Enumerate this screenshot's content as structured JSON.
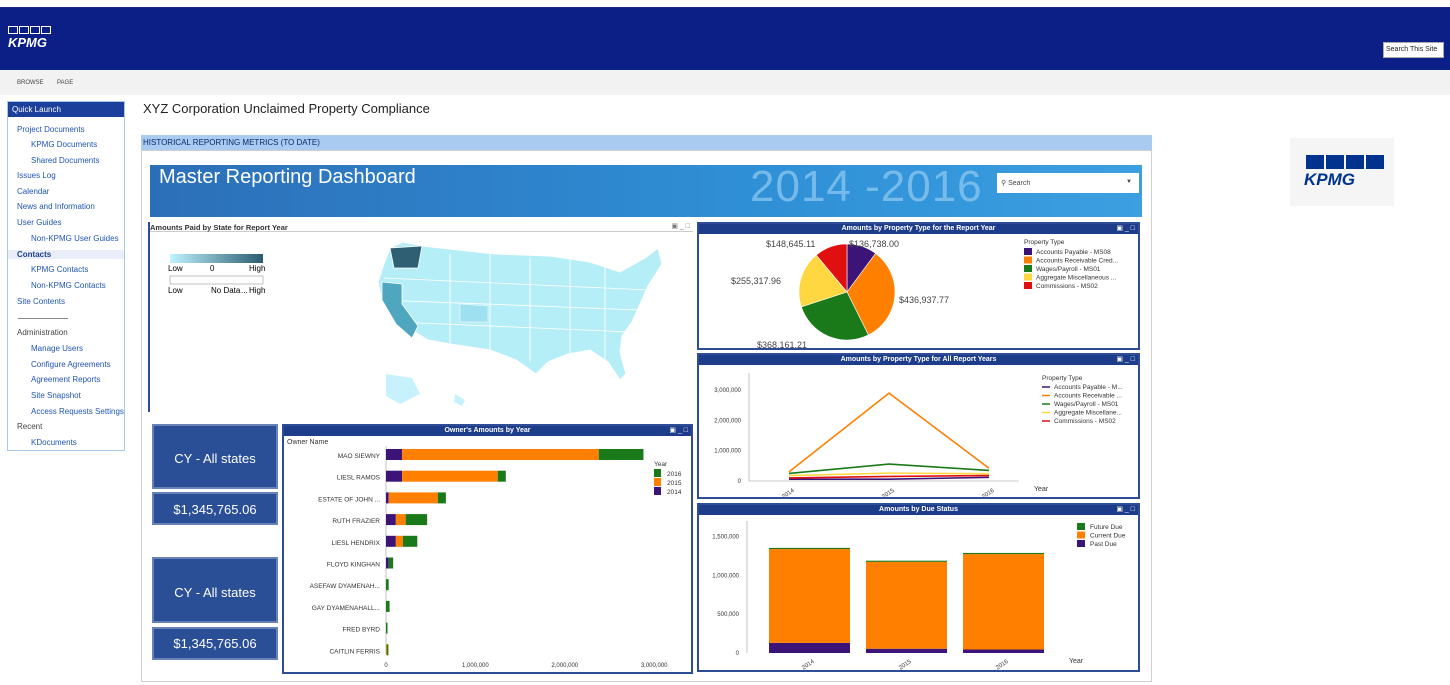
{
  "header": {
    "logo_text": "KPMG",
    "search_placeholder": "Search This Site"
  },
  "ribbon": {
    "tabs": [
      "BROWSE",
      "PAGE"
    ]
  },
  "nav": {
    "quick_launch": "Quick Launch",
    "items": [
      "Project Documents",
      "KPMG Documents",
      "Shared Documents",
      "Issues Log",
      "Calendar",
      "News and Information",
      "User Guides",
      "Non-KPMG User Guides",
      "Contacts",
      "KPMG Contacts",
      "Non-KPMG Contacts",
      "Site Contents",
      "Administration",
      "Manage Users",
      "Configure Agreements",
      "Agreement Reports",
      "Site Snapshot",
      "Access Requests Settings",
      "Recent",
      "KDocuments"
    ]
  },
  "page": {
    "title": "XYZ Corporation Unclaimed Property Compliance",
    "section": "HISTORICAL REPORTING METRICS (TO DATE)"
  },
  "dashboard": {
    "title": "Master Reporting Dashboard",
    "years": "2014 -2016",
    "search_placeholder": "Search"
  },
  "map": {
    "title": "Amounts Paid by State for Report Year",
    "legend": {
      "low": "Low",
      "zero": "0",
      "high": "High",
      "nodata": "No Data",
      "ellipsis": "..."
    }
  },
  "kpis": [
    {
      "label": "CY - All states",
      "value": "$1,345,765.06"
    },
    {
      "label": "CY - All states",
      "value": "$1,345,765.06"
    }
  ],
  "colors": {
    "payable": "#3c1478",
    "receivable": "#ff8000",
    "wages": "#1a7a1a",
    "aggregate": "#ffd740",
    "commissions": "#e01010"
  },
  "chart_data": [
    {
      "type": "bar",
      "title": "Owner's Amounts by Year",
      "ylabel": "Owner Name",
      "legend_title": "Year",
      "categories": [
        "MAO SIEWNY",
        "LIESL RAMOS",
        "ESTATE OF JOHN ...",
        "RUTH FRAZIER",
        "LIESL HENDRIX",
        "FLOYD KINGHAN",
        "ASEFAW DYAMENAH...",
        "GAY DYAMENAHALL...",
        "FRED BYRD",
        "CAITLIN FERRIS"
      ],
      "series": [
        {
          "name": "2014",
          "values": [
            180000,
            180000,
            30000,
            110000,
            110000,
            30000,
            0,
            0,
            0,
            0
          ]
        },
        {
          "name": "2015",
          "values": [
            2200000,
            1070000,
            550000,
            110000,
            80000,
            0,
            0,
            0,
            0,
            10000
          ]
        },
        {
          "name": "2016",
          "values": [
            500000,
            90000,
            90000,
            240000,
            160000,
            50000,
            30000,
            40000,
            10000,
            10000
          ]
        }
      ],
      "xticks": [
        "0",
        "1,000,000",
        "2,000,000",
        "3,000,000"
      ],
      "xlim": [
        0,
        3300000
      ]
    },
    {
      "type": "pie",
      "title": "Amounts by Property Type for the Report Year",
      "legend_title": "Property Type",
      "labels": [
        "Accounts Payable - MS08",
        "Accounts Receivable Cred...",
        "Wages/Payroll - MS01",
        "Aggregate Miscellaneous ...",
        "Commissions - MS02"
      ],
      "values": [
        136738.0,
        436937.77,
        368161.21,
        255317.96,
        148645.11
      ],
      "data_labels": [
        "$136,738.00",
        "$436,937.77",
        "$368,161.21",
        "$255,317.96",
        "$148,645.11"
      ]
    },
    {
      "type": "line",
      "title": "Amounts by Property Type for All Report Years",
      "legend_title": "Property Type",
      "xlabel": "Year",
      "x": [
        "2014",
        "2015",
        "2016"
      ],
      "yticks": [
        "0",
        "1,000,000",
        "2,000,000",
        "3,000,000"
      ],
      "ylim": [
        0,
        3300000
      ],
      "series": [
        {
          "name": "Accounts Payable - M...",
          "values": [
            60000,
            60000,
            120000
          ]
        },
        {
          "name": "Accounts Receivable ...",
          "values": [
            300000,
            2900000,
            420000
          ]
        },
        {
          "name": "Wages/Payroll - MS01",
          "values": [
            250000,
            560000,
            350000
          ]
        },
        {
          "name": "Aggregate Miscellane...",
          "values": [
            180000,
            260000,
            240000
          ]
        },
        {
          "name": "Commissions - MS02",
          "values": [
            100000,
            150000,
            180000
          ]
        }
      ]
    },
    {
      "type": "bar",
      "title": "Amounts by Due Status",
      "xlabel": "Year",
      "categories": [
        "2014",
        "2015",
        "2016"
      ],
      "yticks": [
        "0",
        "500,000",
        "1,000,000",
        "1,500,000"
      ],
      "ylim": [
        0,
        1650000
      ],
      "series": [
        {
          "name": "Past Due",
          "values": [
            130000,
            55000,
            45000
          ]
        },
        {
          "name": "Current Due",
          "values": [
            1210000,
            1120000,
            1230000
          ]
        },
        {
          "name": "Future Due",
          "values": [
            15000,
            15000,
            15000
          ]
        }
      ]
    }
  ]
}
